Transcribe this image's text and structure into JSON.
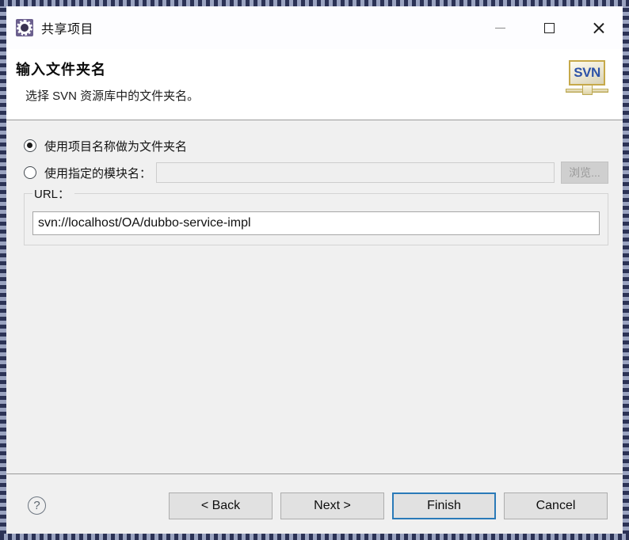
{
  "window": {
    "title": "共享项目",
    "icon": "gear-icon",
    "controls": {
      "minimize": "minimize-icon",
      "maximize": "maximize-icon",
      "close": "close-icon"
    }
  },
  "header": {
    "title": "输入文件夹名",
    "description": "选择 SVN 资源库中的文件夹名。",
    "badge_text": "SVN",
    "badge_icon": "svn-monitor-icon"
  },
  "options": {
    "use_project_name": {
      "label": "使用项目名称做为文件夹名",
      "selected": true
    },
    "use_module_name": {
      "label": "使用指定的模块名：",
      "selected": false,
      "input_value": "",
      "input_placeholder": "",
      "browse_label": "浏览..."
    }
  },
  "url_group": {
    "legend": "URL：",
    "value": "svn://localhost/OA/dubbo-service-impl"
  },
  "footer": {
    "help_label": "?",
    "buttons": {
      "back": "< Back",
      "next": "Next >",
      "finish": "Finish",
      "cancel": "Cancel"
    }
  },
  "colors": {
    "focus_blue": "#2a7ab8",
    "dialog_bg": "#f0f0f0",
    "header_bg": "#ffffff",
    "svn_text": "#2d52a8"
  }
}
